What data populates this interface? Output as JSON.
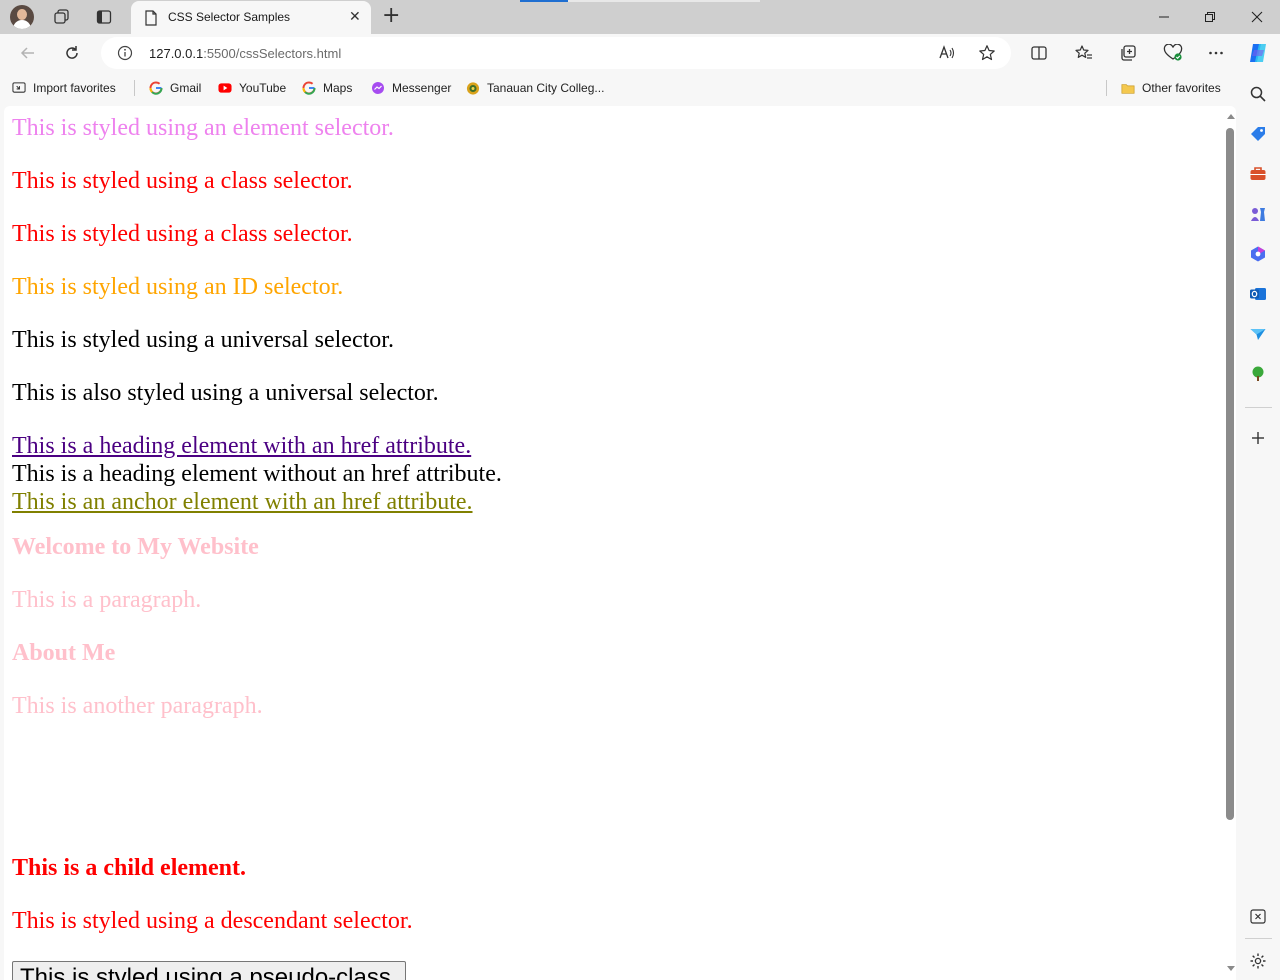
{
  "browser": {
    "tab_title": "CSS Selector Samples",
    "url_host": "127.0.0.1",
    "url_rest": ":5500/cssSelectors.html",
    "favorites": [
      "Import favorites",
      "Gmail",
      "YouTube",
      "Maps",
      "Messenger",
      "Tanauan City Colleg..."
    ],
    "other_favorites": "Other favorites"
  },
  "page": {
    "lines": [
      {
        "text": "This is styled using an element selector.",
        "color": "#ee82ee"
      },
      {
        "text": "This is styled using a class selector.",
        "color": "#ff0000"
      },
      {
        "text": "This is styled using a class selector.",
        "color": "#ff0000"
      },
      {
        "text": "This is styled using an ID selector.",
        "color": "#ffa500"
      },
      {
        "text": "This is styled using a universal selector.",
        "color": "#000000"
      },
      {
        "text": "This is also styled using a universal selector.",
        "color": "#000000"
      },
      {
        "text": "This is a heading element with an href attribute.",
        "color": "#4b0082"
      },
      {
        "text": "This is a heading element without an href attribute.",
        "color": "#000000"
      },
      {
        "text": "This is an anchor element with an href attribute.",
        "color": "#808000"
      },
      {
        "text": "Welcome to My Website",
        "color": "#ffc0cb"
      },
      {
        "text": "This is a paragraph.",
        "color": "#ffc0cb"
      },
      {
        "text": "About Me",
        "color": "#ffc0cb"
      },
      {
        "text": "This is another paragraph.",
        "color": "#ffc0cb"
      },
      {
        "text": "This is a child element.",
        "color": "#ff0000"
      },
      {
        "text": "This is styled using a descendant selector.",
        "color": "#ff0000"
      }
    ],
    "button_label": "This is styled using a pseudo-class."
  }
}
